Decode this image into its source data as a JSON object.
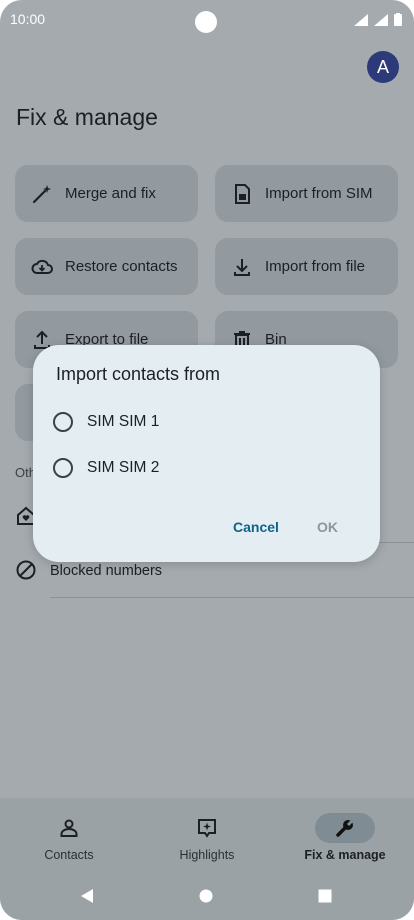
{
  "status": {
    "time": "10:00"
  },
  "avatar": {
    "initial": "A"
  },
  "page": {
    "title": "Fix & manage"
  },
  "cards": {
    "merge": "Merge and fix",
    "import_sim": "Import from SIM",
    "restore": "Restore contacts",
    "import_file": "Import from file",
    "export": "Export to file",
    "bin": "Bin"
  },
  "other": {
    "section_label": "Oth",
    "blocked": "Blocked numbers"
  },
  "dialog": {
    "title": "Import contacts from",
    "options": [
      "SIM SIM 1",
      "SIM SIM 2"
    ],
    "cancel": "Cancel",
    "ok": "OK"
  },
  "nav": {
    "contacts": "Contacts",
    "highlights": "Highlights",
    "fix": "Fix & manage"
  },
  "colors": {
    "accent": "#0e6489",
    "scrim": "#a4aaae",
    "dialog_bg": "#e4eef2"
  }
}
